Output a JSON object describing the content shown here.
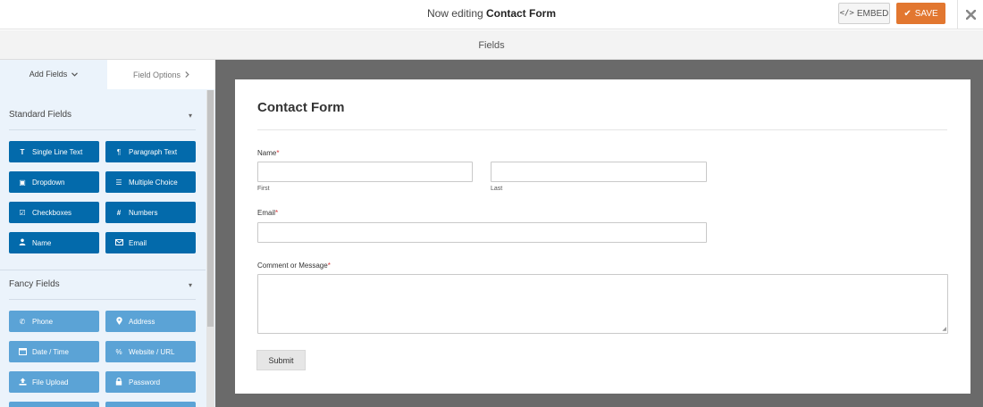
{
  "header": {
    "title_prefix": "Now editing",
    "form_name": "Contact Form",
    "embed_label": "EMBED",
    "save_label": "SAVE",
    "close_icon": "close-icon"
  },
  "section": {
    "label": "Fields"
  },
  "left_panel": {
    "tabs": [
      {
        "label": "Add Fields",
        "icon": "chevron-down-icon"
      },
      {
        "label": "Field Options",
        "icon": "chevron-right-icon"
      }
    ],
    "standard": {
      "heading": "Standard Fields",
      "buttons": [
        {
          "label": "Single Line Text",
          "icon": "text-icon"
        },
        {
          "label": "Paragraph Text",
          "icon": "paragraph-icon"
        },
        {
          "label": "Dropdown",
          "icon": "dropdown-icon"
        },
        {
          "label": "Multiple Choice",
          "icon": "list-icon"
        },
        {
          "label": "Checkboxes",
          "icon": "checkbox-icon"
        },
        {
          "label": "Numbers",
          "icon": "hash-icon"
        },
        {
          "label": "Name",
          "icon": "user-icon"
        },
        {
          "label": "Email",
          "icon": "envelope-icon"
        }
      ]
    },
    "fancy": {
      "heading": "Fancy Fields",
      "buttons": [
        {
          "label": "Phone",
          "icon": "phone-icon"
        },
        {
          "label": "Address",
          "icon": "map-pin-icon"
        },
        {
          "label": "Date / Time",
          "icon": "calendar-icon"
        },
        {
          "label": "Website / URL",
          "icon": "link-icon"
        },
        {
          "label": "File Upload",
          "icon": "upload-icon"
        },
        {
          "label": "Password",
          "icon": "lock-icon"
        }
      ]
    }
  },
  "form": {
    "title": "Contact Form",
    "fields": {
      "name": {
        "label": "Name",
        "required": "*",
        "first": "First",
        "last": "Last"
      },
      "email": {
        "label": "Email",
        "required": "*"
      },
      "message": {
        "label": "Comment or Message",
        "required": "*"
      }
    },
    "submit_label": "Submit"
  },
  "colors": {
    "save": "#e27730",
    "standard_button": "#036aab",
    "fancy_button": "#5ba3d6",
    "canvas_bg": "#6a6a6a",
    "required": "#d63638"
  }
}
